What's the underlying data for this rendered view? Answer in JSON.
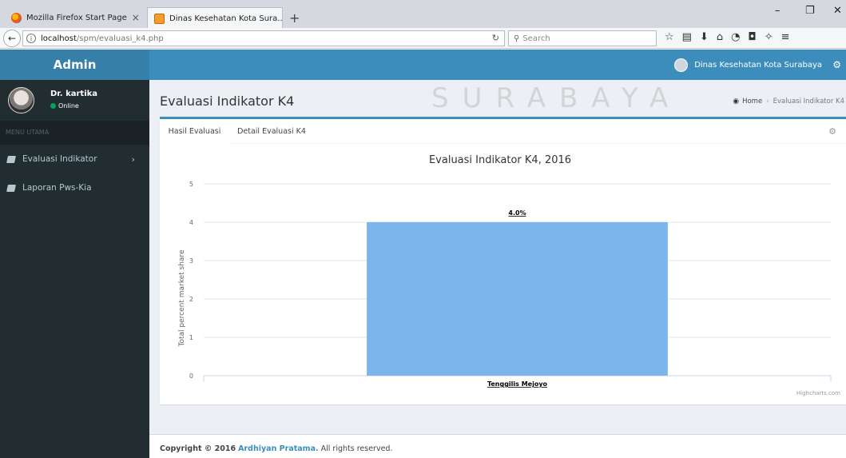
{
  "browser": {
    "tabs": [
      {
        "title": "Mozilla Firefox Start Page",
        "active": false
      },
      {
        "title": "Dinas Kesehatan Kota Sura...",
        "active": true
      }
    ],
    "new_tab_glyph": "+",
    "close_glyph": "×",
    "window_controls": {
      "minimize": "–",
      "restore": "❐",
      "close": "✕"
    },
    "url_host": "localhost",
    "url_path": "/spm/evaluasi_k4.php",
    "search_placeholder": "Search",
    "toolbar_icons": [
      "star-icon",
      "reading-list-icon",
      "download-icon",
      "home-icon",
      "pocket-icon",
      "shield-icon",
      "extension-icon",
      "menu-icon"
    ]
  },
  "header": {
    "logo": "Admin",
    "user_label": "Dinas Kesehatan Kota Surabaya"
  },
  "sidebar": {
    "user_name": "Dr. kartika",
    "status": "Online",
    "menu_header": "MENU UTAMA",
    "items": [
      {
        "label": "Evaluasi Indikator",
        "has_submenu": true
      },
      {
        "label": "Laporan Pws-Kia",
        "has_submenu": false
      }
    ]
  },
  "content": {
    "page_title": "Evaluasi Indikator K4",
    "breadcrumb": {
      "home": "Home",
      "current": "Evaluasi Indikator K4"
    },
    "tabs": [
      {
        "label": "Hasil Evaluasi",
        "active": true
      },
      {
        "label": "Detail Evaluasi K4",
        "active": false
      }
    ],
    "watermark": "SURABAYA"
  },
  "chart_data": {
    "type": "bar",
    "title": "Evaluasi Indikator K4, 2016",
    "ylabel": "Total percent market share",
    "xlabel": "",
    "categories": [
      "Tenggilis Mejoyo"
    ],
    "series": [
      {
        "values": [
          4.0
        ]
      }
    ],
    "data_labels": [
      "4.0%"
    ],
    "ylim": [
      0,
      5
    ],
    "yticks": [
      0,
      1,
      2,
      3,
      4,
      5
    ],
    "grid": true,
    "bar_color": "#7cb5ec",
    "credits": "Highcharts.com"
  },
  "footer": {
    "prefix": "Copyright © 2016",
    "author": "Ardhiyan Pratama.",
    "suffix": "All rights reserved."
  }
}
